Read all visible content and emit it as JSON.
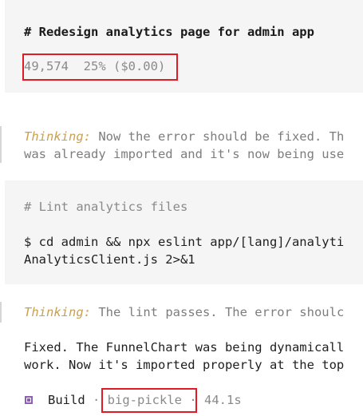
{
  "task": {
    "title": "# Redesign analytics page for admin app",
    "stats": "49,574  25% ($0.00)"
  },
  "thinking1": {
    "label": "Thinking:",
    "line1": " Now the error should be fixed. Th",
    "line2": "was already imported and it's now being use"
  },
  "command": {
    "comment": "# Lint analytics files",
    "line1": "$ cd admin && npx eslint app/[lang]/analyti",
    "line2": "AnalyticsClient.js 2>&1"
  },
  "thinking2": {
    "label": "Thinking:",
    "line1": " The lint passes. The error shoulc"
  },
  "result": {
    "line1": "Fixed. The FunnelChart was being dynamicall",
    "line2": "work. Now it's imported properly at the top"
  },
  "footer": {
    "icon": "build-icon",
    "mode": "Build",
    "sep1": " · ",
    "model": "big-pickle",
    "sep2": " · ",
    "duration": "44.1s"
  },
  "colors": {
    "highlight": "#e01b24",
    "thinking_label": "#c9a050",
    "build_icon": "#8c5fb5",
    "block_bg": "#f5f5f5"
  }
}
